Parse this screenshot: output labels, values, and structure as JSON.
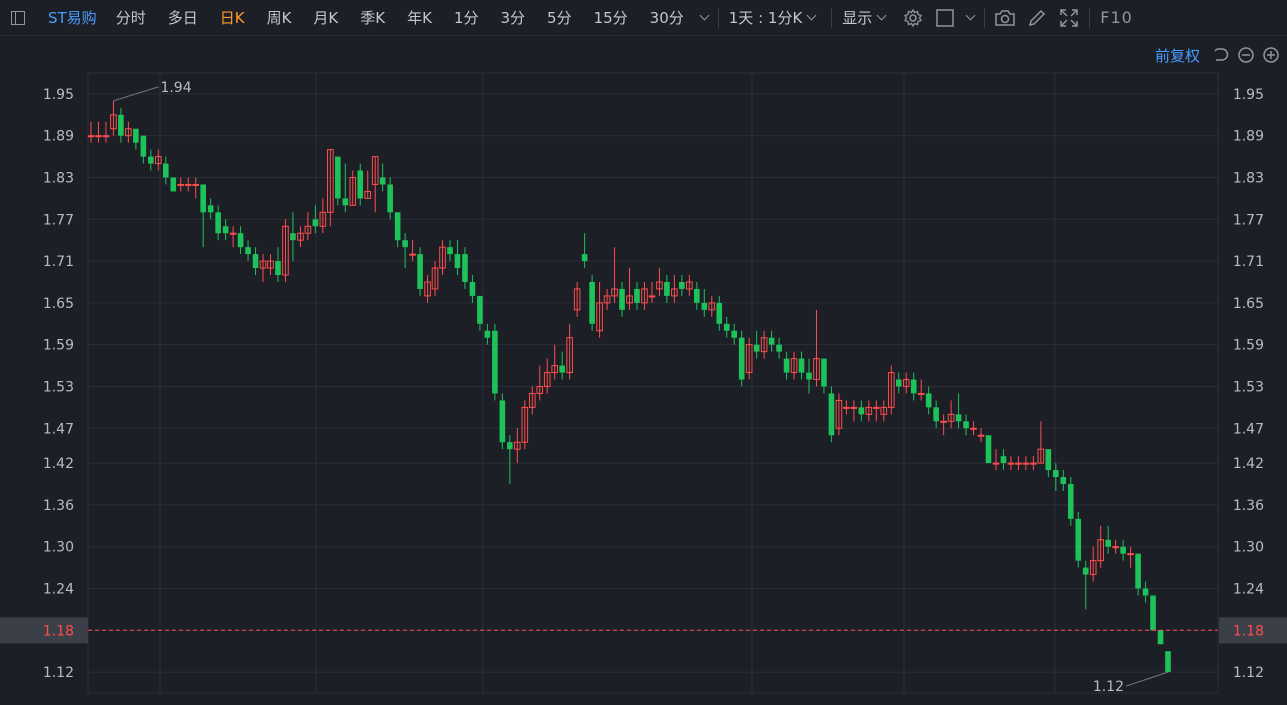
{
  "toolbar": {
    "stock_name": "ST易购",
    "periods": [
      "分时",
      "多日",
      "日K",
      "周K",
      "月K",
      "季K",
      "年K",
      "1分",
      "3分",
      "5分",
      "15分",
      "30分"
    ],
    "active_period": "日K",
    "intraday_select": "1天 : 1分K",
    "display_label": "显示",
    "f10_label": "F10"
  },
  "sub_bar": {
    "adjust_label": "前复权"
  },
  "colors": {
    "up": "#ff4d4d",
    "down": "#1ec25a",
    "background": "#1c1f26",
    "grid": "#2b2f37",
    "highlight": "#ff4d4d"
  },
  "chart_data": {
    "type": "candlestick",
    "y_ticks": [
      "1.95",
      "1.89",
      "1.83",
      "1.77",
      "1.71",
      "1.65",
      "1.59",
      "1.53",
      "1.47",
      "1.42",
      "1.36",
      "1.30",
      "1.24",
      "1.18",
      "1.12"
    ],
    "ylim": [
      1.09,
      1.98
    ],
    "current_price": "1.18",
    "max_label": "1.94",
    "min_label": "1.12",
    "candles": [
      [
        1.89,
        1.89,
        1.91,
        1.88
      ],
      [
        1.89,
        1.89,
        1.91,
        1.88
      ],
      [
        1.89,
        1.89,
        1.91,
        1.88
      ],
      [
        1.9,
        1.92,
        1.94,
        1.89
      ],
      [
        1.92,
        1.89,
        1.93,
        1.88
      ],
      [
        1.89,
        1.9,
        1.91,
        1.88
      ],
      [
        1.9,
        1.88,
        1.9,
        1.87
      ],
      [
        1.89,
        1.86,
        1.89,
        1.85
      ],
      [
        1.86,
        1.85,
        1.87,
        1.84
      ],
      [
        1.85,
        1.86,
        1.87,
        1.84
      ],
      [
        1.85,
        1.83,
        1.86,
        1.82
      ],
      [
        1.83,
        1.81,
        1.83,
        1.81
      ],
      [
        1.82,
        1.82,
        1.83,
        1.81
      ],
      [
        1.82,
        1.82,
        1.83,
        1.81
      ],
      [
        1.82,
        1.82,
        1.83,
        1.8
      ],
      [
        1.82,
        1.78,
        1.82,
        1.73
      ],
      [
        1.79,
        1.78,
        1.8,
        1.77
      ],
      [
        1.78,
        1.75,
        1.79,
        1.74
      ],
      [
        1.76,
        1.75,
        1.77,
        1.74
      ],
      [
        1.75,
        1.75,
        1.76,
        1.73
      ],
      [
        1.75,
        1.73,
        1.76,
        1.72
      ],
      [
        1.73,
        1.72,
        1.74,
        1.71
      ],
      [
        1.72,
        1.7,
        1.73,
        1.69
      ],
      [
        1.7,
        1.71,
        1.72,
        1.68
      ],
      [
        1.7,
        1.71,
        1.72,
        1.69
      ],
      [
        1.71,
        1.69,
        1.73,
        1.68
      ],
      [
        1.69,
        1.76,
        1.77,
        1.68
      ],
      [
        1.75,
        1.74,
        1.78,
        1.71
      ],
      [
        1.74,
        1.75,
        1.76,
        1.73
      ],
      [
        1.75,
        1.76,
        1.78,
        1.74
      ],
      [
        1.77,
        1.76,
        1.79,
        1.75
      ],
      [
        1.76,
        1.78,
        1.8,
        1.75
      ],
      [
        1.78,
        1.87,
        1.87,
        1.76
      ],
      [
        1.86,
        1.8,
        1.86,
        1.79
      ],
      [
        1.8,
        1.79,
        1.85,
        1.78
      ],
      [
        1.79,
        1.83,
        1.84,
        1.79
      ],
      [
        1.84,
        1.8,
        1.85,
        1.79
      ],
      [
        1.8,
        1.81,
        1.84,
        1.8
      ],
      [
        1.82,
        1.86,
        1.86,
        1.78
      ],
      [
        1.83,
        1.82,
        1.85,
        1.81
      ],
      [
        1.82,
        1.78,
        1.83,
        1.77
      ],
      [
        1.78,
        1.74,
        1.78,
        1.73
      ],
      [
        1.74,
        1.73,
        1.75,
        1.7
      ],
      [
        1.72,
        1.72,
        1.74,
        1.71
      ],
      [
        1.72,
        1.67,
        1.73,
        1.66
      ],
      [
        1.66,
        1.68,
        1.69,
        1.65
      ],
      [
        1.67,
        1.7,
        1.71,
        1.66
      ],
      [
        1.7,
        1.73,
        1.74,
        1.69
      ],
      [
        1.73,
        1.72,
        1.74,
        1.71
      ],
      [
        1.72,
        1.7,
        1.74,
        1.69
      ],
      [
        1.72,
        1.68,
        1.73,
        1.67
      ],
      [
        1.68,
        1.66,
        1.69,
        1.65
      ],
      [
        1.66,
        1.62,
        1.66,
        1.61
      ],
      [
        1.61,
        1.6,
        1.62,
        1.59
      ],
      [
        1.61,
        1.52,
        1.62,
        1.51
      ],
      [
        1.51,
        1.45,
        1.52,
        1.44
      ],
      [
        1.45,
        1.44,
        1.46,
        1.39
      ],
      [
        1.44,
        1.45,
        1.47,
        1.42
      ],
      [
        1.45,
        1.5,
        1.51,
        1.44
      ],
      [
        1.5,
        1.52,
        1.53,
        1.49
      ],
      [
        1.52,
        1.53,
        1.56,
        1.51
      ],
      [
        1.53,
        1.55,
        1.57,
        1.52
      ],
      [
        1.55,
        1.56,
        1.59,
        1.54
      ],
      [
        1.56,
        1.55,
        1.58,
        1.54
      ],
      [
        1.55,
        1.6,
        1.62,
        1.54
      ],
      [
        1.64,
        1.67,
        1.68,
        1.63
      ],
      [
        1.72,
        1.71,
        1.75,
        1.7
      ],
      [
        1.68,
        1.62,
        1.69,
        1.61
      ],
      [
        1.61,
        1.65,
        1.68,
        1.6
      ],
      [
        1.65,
        1.66,
        1.67,
        1.64
      ],
      [
        1.66,
        1.67,
        1.73,
        1.65
      ],
      [
        1.67,
        1.64,
        1.68,
        1.63
      ],
      [
        1.65,
        1.66,
        1.7,
        1.64
      ],
      [
        1.67,
        1.65,
        1.68,
        1.64
      ],
      [
        1.65,
        1.67,
        1.68,
        1.64
      ],
      [
        1.66,
        1.66,
        1.68,
        1.65
      ],
      [
        1.67,
        1.68,
        1.7,
        1.66
      ],
      [
        1.68,
        1.66,
        1.69,
        1.65
      ],
      [
        1.66,
        1.67,
        1.69,
        1.65
      ],
      [
        1.68,
        1.67,
        1.69,
        1.66
      ],
      [
        1.67,
        1.68,
        1.69,
        1.66
      ],
      [
        1.67,
        1.65,
        1.68,
        1.64
      ],
      [
        1.65,
        1.64,
        1.67,
        1.63
      ],
      [
        1.64,
        1.65,
        1.66,
        1.63
      ],
      [
        1.65,
        1.62,
        1.66,
        1.61
      ],
      [
        1.62,
        1.61,
        1.63,
        1.6
      ],
      [
        1.61,
        1.6,
        1.62,
        1.59
      ],
      [
        1.6,
        1.54,
        1.61,
        1.53
      ],
      [
        1.55,
        1.59,
        1.6,
        1.54
      ],
      [
        1.59,
        1.58,
        1.61,
        1.57
      ],
      [
        1.58,
        1.6,
        1.61,
        1.57
      ],
      [
        1.6,
        1.59,
        1.61,
        1.58
      ],
      [
        1.59,
        1.58,
        1.6,
        1.57
      ],
      [
        1.57,
        1.55,
        1.58,
        1.54
      ],
      [
        1.55,
        1.57,
        1.58,
        1.54
      ],
      [
        1.57,
        1.55,
        1.58,
        1.54
      ],
      [
        1.55,
        1.54,
        1.57,
        1.52
      ],
      [
        1.54,
        1.57,
        1.64,
        1.53
      ],
      [
        1.57,
        1.53,
        1.57,
        1.52
      ],
      [
        1.52,
        1.46,
        1.53,
        1.45
      ],
      [
        1.47,
        1.51,
        1.52,
        1.46
      ],
      [
        1.5,
        1.5,
        1.51,
        1.49
      ],
      [
        1.5,
        1.5,
        1.51,
        1.48
      ],
      [
        1.5,
        1.49,
        1.51,
        1.48
      ],
      [
        1.49,
        1.5,
        1.51,
        1.48
      ],
      [
        1.5,
        1.5,
        1.51,
        1.48
      ],
      [
        1.49,
        1.5,
        1.51,
        1.48
      ],
      [
        1.5,
        1.55,
        1.56,
        1.49
      ],
      [
        1.54,
        1.53,
        1.55,
        1.52
      ],
      [
        1.53,
        1.54,
        1.55,
        1.52
      ],
      [
        1.54,
        1.52,
        1.55,
        1.51
      ],
      [
        1.52,
        1.52,
        1.54,
        1.51
      ],
      [
        1.52,
        1.5,
        1.53,
        1.49
      ],
      [
        1.5,
        1.48,
        1.51,
        1.47
      ],
      [
        1.48,
        1.48,
        1.49,
        1.46
      ],
      [
        1.48,
        1.49,
        1.51,
        1.47
      ],
      [
        1.49,
        1.48,
        1.52,
        1.47
      ],
      [
        1.48,
        1.47,
        1.49,
        1.46
      ],
      [
        1.47,
        1.47,
        1.48,
        1.46
      ],
      [
        1.46,
        1.46,
        1.47,
        1.45
      ],
      [
        1.46,
        1.42,
        1.46,
        1.42
      ],
      [
        1.42,
        1.42,
        1.44,
        1.41
      ],
      [
        1.43,
        1.42,
        1.44,
        1.41
      ],
      [
        1.42,
        1.42,
        1.43,
        1.41
      ],
      [
        1.42,
        1.42,
        1.43,
        1.41
      ],
      [
        1.42,
        1.42,
        1.43,
        1.41
      ],
      [
        1.42,
        1.42,
        1.43,
        1.41
      ],
      [
        1.42,
        1.44,
        1.48,
        1.42
      ],
      [
        1.44,
        1.41,
        1.44,
        1.4
      ],
      [
        1.41,
        1.4,
        1.42,
        1.38
      ],
      [
        1.4,
        1.39,
        1.41,
        1.38
      ],
      [
        1.39,
        1.34,
        1.4,
        1.33
      ],
      [
        1.34,
        1.28,
        1.35,
        1.27
      ],
      [
        1.27,
        1.26,
        1.28,
        1.21
      ],
      [
        1.26,
        1.28,
        1.3,
        1.25
      ],
      [
        1.28,
        1.31,
        1.33,
        1.27
      ],
      [
        1.31,
        1.3,
        1.33,
        1.29
      ],
      [
        1.3,
        1.3,
        1.31,
        1.29
      ],
      [
        1.3,
        1.29,
        1.31,
        1.28
      ],
      [
        1.29,
        1.29,
        1.3,
        1.27
      ],
      [
        1.29,
        1.24,
        1.29,
        1.23
      ],
      [
        1.24,
        1.23,
        1.25,
        1.22
      ],
      [
        1.23,
        1.18,
        1.23,
        1.18
      ],
      [
        1.18,
        1.16,
        1.18,
        1.16
      ],
      [
        1.15,
        1.12,
        1.15,
        1.12
      ]
    ]
  }
}
